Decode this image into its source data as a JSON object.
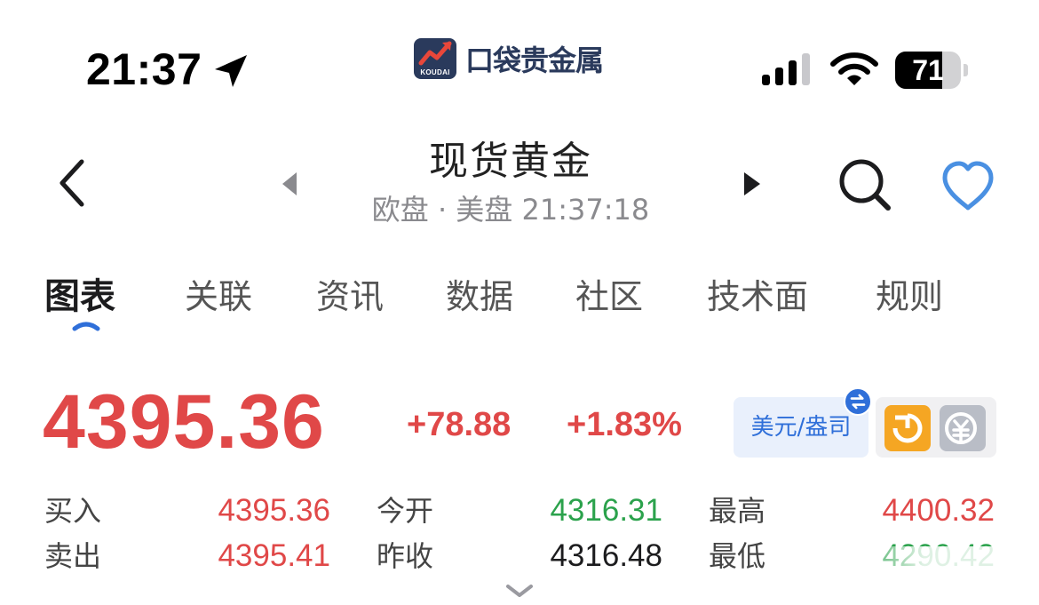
{
  "status_bar": {
    "time": "21:37",
    "battery_level": 71,
    "battery_text": "71"
  },
  "app_logo": {
    "badge_text": "KOUDAI",
    "name": "口袋贵金属"
  },
  "header": {
    "title": "现货黄金",
    "subtitle": "欧盘 · 美盘 21:37:18"
  },
  "tabs": [
    {
      "label": "图表",
      "active": true
    },
    {
      "label": "关联",
      "active": false
    },
    {
      "label": "资讯",
      "active": false
    },
    {
      "label": "数据",
      "active": false
    },
    {
      "label": "社区",
      "active": false
    },
    {
      "label": "技术面",
      "active": false
    },
    {
      "label": "规则",
      "active": false
    }
  ],
  "quote": {
    "price": "4395.36",
    "change": "+78.88",
    "change_pct": "+1.83%",
    "currency_unit": "美元/盎司"
  },
  "quote_stats": {
    "buy_label": "买入",
    "buy_value": "4395.36",
    "sell_label": "卖出",
    "sell_value": "4395.41",
    "open_label": "今开",
    "open_value": "4316.31",
    "prev_close_label": "昨收",
    "prev_close_value": "4316.48",
    "high_label": "最高",
    "high_value": "4400.32",
    "low_label": "最低",
    "low_value": "4290.42"
  },
  "colors": {
    "up": "#e04848",
    "down": "#2ba24c",
    "accent": "#2f6fd9"
  },
  "icons": [
    "location-arrow-icon",
    "cellular-signal-icon",
    "wifi-icon",
    "back-chevron-icon",
    "prev-triangle-icon",
    "next-triangle-icon",
    "search-icon",
    "heart-icon",
    "swap-icon",
    "refresh-icon",
    "calculator-icon",
    "chevron-down-icon"
  ]
}
